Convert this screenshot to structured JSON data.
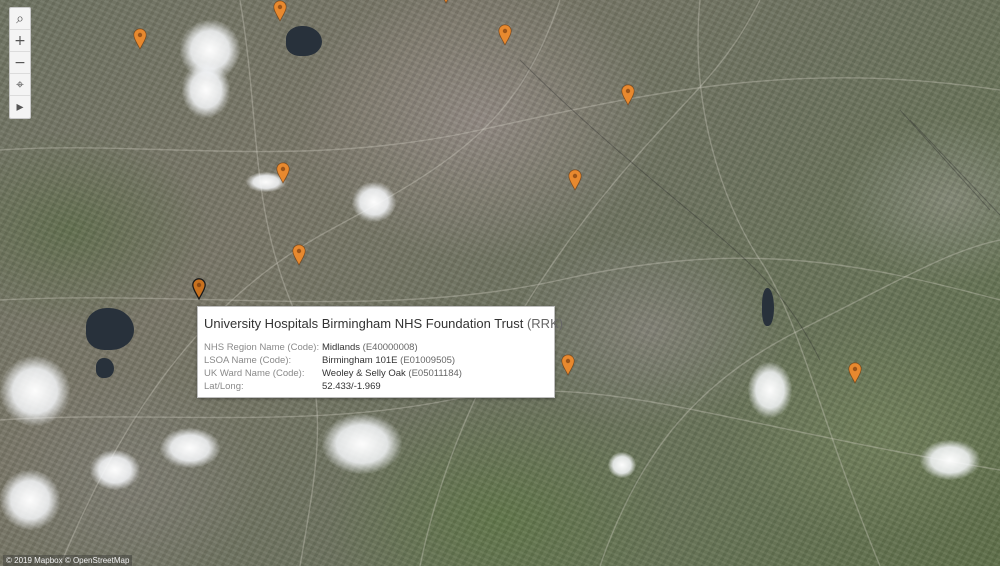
{
  "map": {
    "controls": [
      {
        "name": "search-button",
        "glyph": "⌕"
      },
      {
        "name": "zoom-in-button",
        "glyph": "+"
      },
      {
        "name": "zoom-out-button",
        "glyph": "−"
      },
      {
        "name": "reset-map-button",
        "glyph": "⌖"
      },
      {
        "name": "expand-toolbar-button",
        "glyph": "▸"
      }
    ],
    "marker_color": "#e8892f",
    "selected_marker_color": "#c9711e"
  },
  "tooltip": {
    "title": "University Hospitals Birmingham NHS Foundation Trust",
    "title_code": "(RRK)",
    "rows": [
      {
        "key": "NHS Region Name (Code):",
        "value": "Midlands",
        "code": "(E40000008)"
      },
      {
        "key": "LSOA Name (Code):",
        "value": "Birmingham 101E",
        "code": "(E01009505)"
      },
      {
        "key": "UK Ward Name (Code):",
        "value": "Weoley & Selly Oak",
        "code": "(E05011184)"
      },
      {
        "key": "Lat/Long:",
        "value": "52.433/-1.969",
        "code": ""
      }
    ]
  },
  "attribution": "© 2019 Mapbox © OpenStreetMap"
}
